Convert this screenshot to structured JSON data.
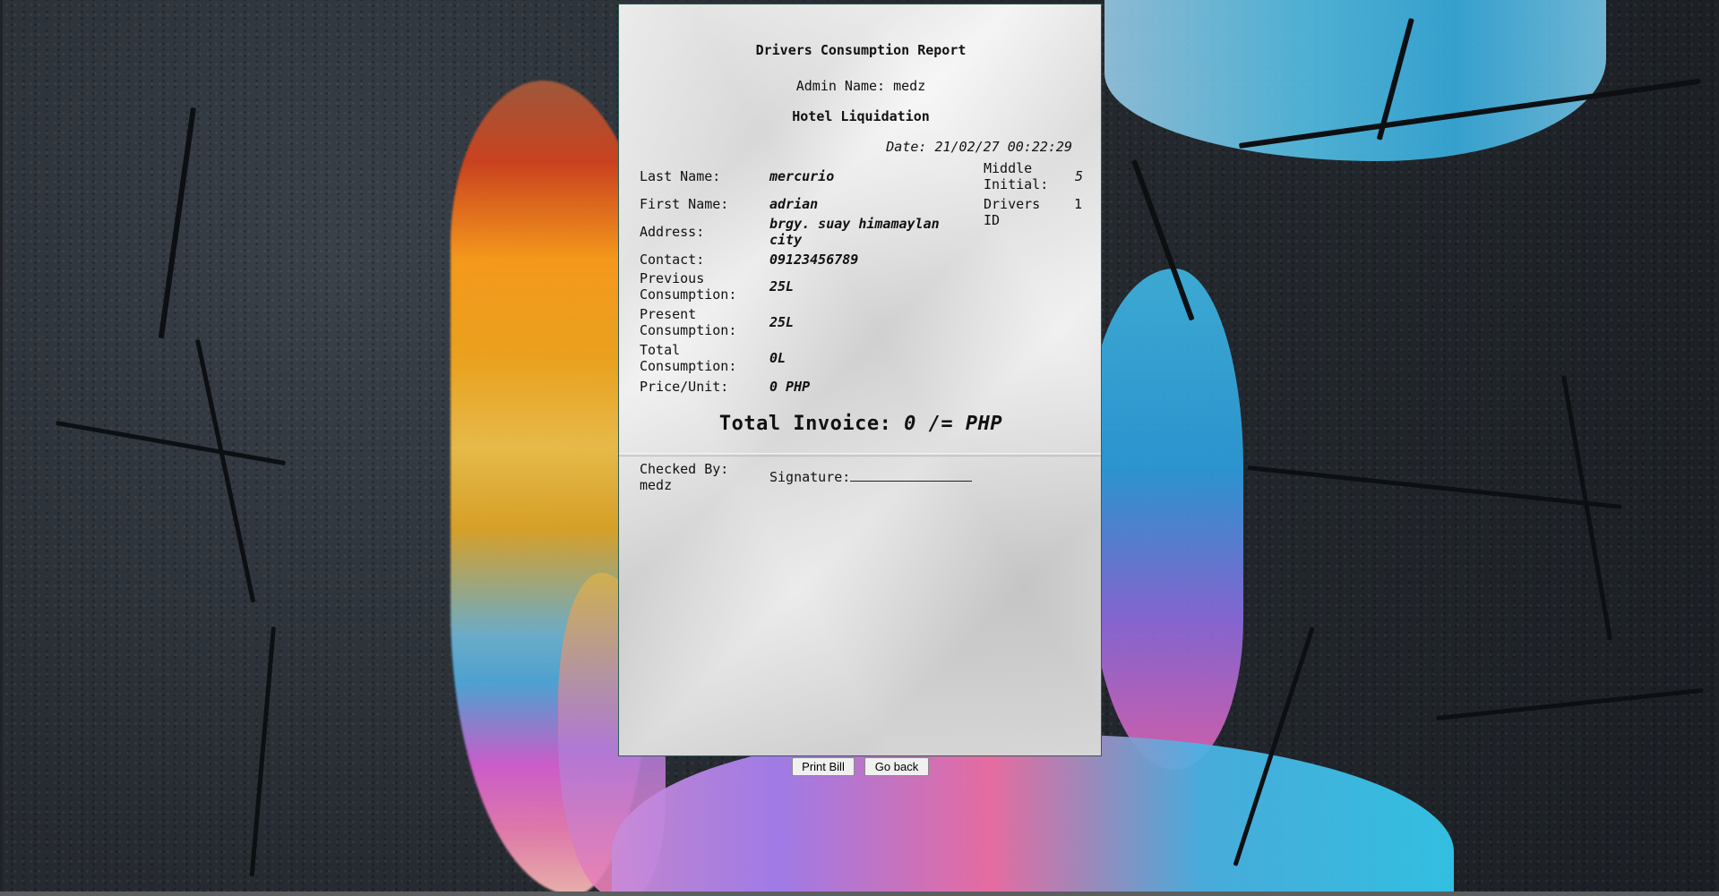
{
  "report": {
    "title": "Drivers Consumption Report",
    "admin_line": "Admin Name: medz",
    "company": "Hotel Liquidation",
    "date_line": "Date: 21/02/27 00:22:29"
  },
  "fields": {
    "last_name_label": "Last Name:",
    "last_name_value": "mercurio",
    "first_name_label": "First Name:",
    "first_name_value": "adrian",
    "address_label": "Address:",
    "address_value": "brgy. suay himamaylan city",
    "contact_label": "Contact:",
    "contact_value": "09123456789",
    "previous_label": "Previous Consumption:",
    "previous_value": "25L",
    "present_label": "Present Consumption:",
    "present_value": "25L",
    "total_label": "Total Consumption:",
    "total_value": "0L",
    "price_label": "Price/Unit:",
    "price_value": "0 PHP",
    "middle_initial_label": "Middle Initial:",
    "middle_initial_value": "5",
    "drivers_id_label": "Drivers ID",
    "drivers_id_value": "1"
  },
  "invoice": {
    "label": "Total Invoice:",
    "amount": "0 /= PHP"
  },
  "footer": {
    "checked_by": "Checked By: medz",
    "signature_label": "Signature:"
  },
  "buttons": {
    "print": "Print Bill",
    "back": "Go back"
  }
}
